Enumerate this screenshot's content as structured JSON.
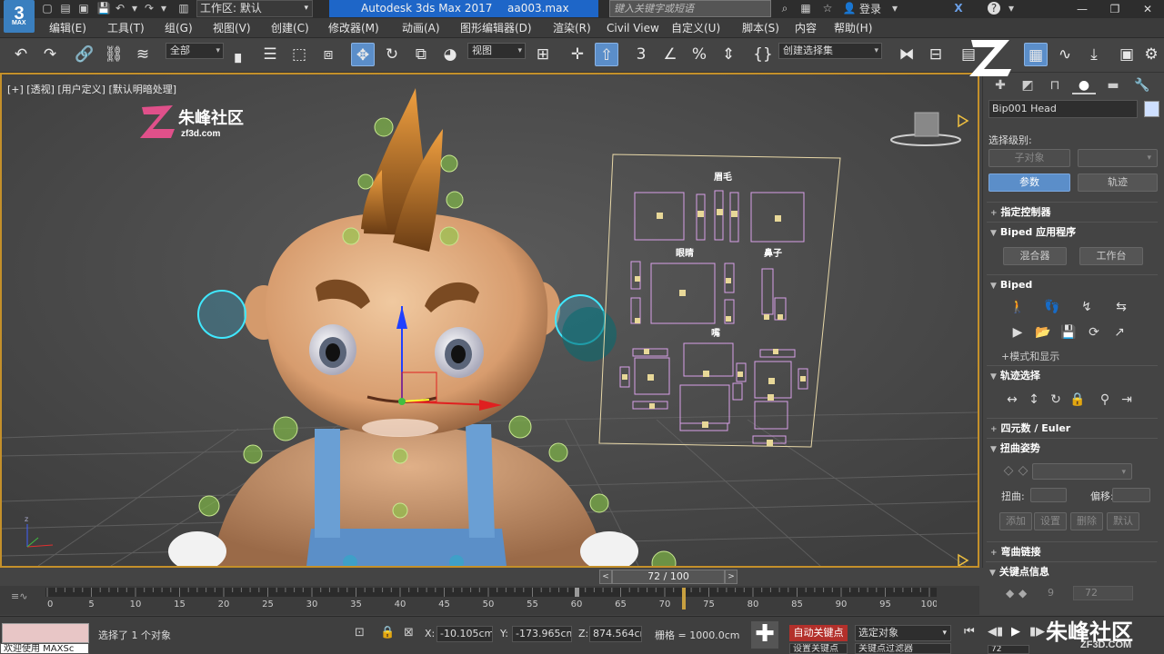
{
  "title_bar": {
    "workspace_label": "工作区: 默认",
    "app_title": "Autodesk 3ds Max 2017",
    "file_name": "aa003.max",
    "search_placeholder": "键入关键字或短语",
    "login_label": "登录",
    "help_label": "?"
  },
  "logo": {
    "text": "3",
    "sub": "MAX"
  },
  "menu": [
    "编辑(E)",
    "工具(T)",
    "组(G)",
    "视图(V)",
    "创建(C)",
    "修改器(M)",
    "动画(A)",
    "图形编辑器(D)",
    "渲染(R)",
    "Civil View",
    "自定义(U)",
    "脚本(S)",
    "内容",
    "帮助(H)"
  ],
  "toolbar": {
    "filter_dropdown": "全部",
    "ref_coord_dropdown": "视图",
    "selection_set_dropdown": "创建选择集"
  },
  "viewport": {
    "label": "[+] [透视] [用户定义] [默认明暗处理]",
    "watermark_brand": "朱峰社区",
    "watermark_url": "zf3d.com",
    "face_panel": {
      "brows": "眉毛",
      "eyes": "眼睛",
      "nose": "鼻子",
      "mouth": "嘴"
    }
  },
  "command_panel": {
    "object_name": "Bip001 Head",
    "selection_level_label": "选择级别:",
    "sub_object_button": "子对象",
    "params_button": "参数",
    "trajectory_button": "轨迹",
    "rollouts": {
      "assign_controller": "指定控制器",
      "biped_apps": "Biped 应用程序",
      "mixer": "混合器",
      "workbench": "工作台",
      "biped": "Biped",
      "mode_display": "+模式和显示",
      "track_selection": "轨迹选择",
      "quaternion_euler": "四元数 / Euler",
      "twist_pose": "扭曲姿势",
      "twist_label": "扭曲:",
      "offset_label": "偏移:",
      "add": "添加",
      "set": "设置",
      "delete": "删除",
      "default": "默认",
      "bend_links": "弯曲链接",
      "key_info": "关键点信息",
      "key_number": "9",
      "key_frame": "72"
    }
  },
  "timeline": {
    "current": "72 / 100",
    "ticks": [
      "0",
      "5",
      "10",
      "15",
      "20",
      "25",
      "30",
      "35",
      "40",
      "45",
      "50",
      "55",
      "60",
      "65",
      "70",
      "75",
      "80",
      "85",
      "90",
      "95",
      "100"
    ]
  },
  "status": {
    "welcome": "欢迎使用 MAXSc",
    "selection_msg": "选择了 1 个对象",
    "x_label": "X:",
    "x_value": "-10.105cm",
    "y_label": "Y:",
    "y_value": "-173.965cm",
    "z_label": "Z:",
    "z_value": "874.564cm",
    "grid": "栅格 = 1000.0cm",
    "auto_key": "自动关键点",
    "set_key": "设置关键点",
    "selected_object": "选定对象",
    "key_filter": "关键点过滤器",
    "frame_value": "72"
  },
  "brand_watermark": {
    "text": "朱峰社区",
    "url": "ZF3D.COM"
  },
  "colors": {
    "accent": "#5b8ec9",
    "viewport_border": "#c4902a",
    "autokey": "#b3302b",
    "title_highlight": "#1e66c8"
  }
}
